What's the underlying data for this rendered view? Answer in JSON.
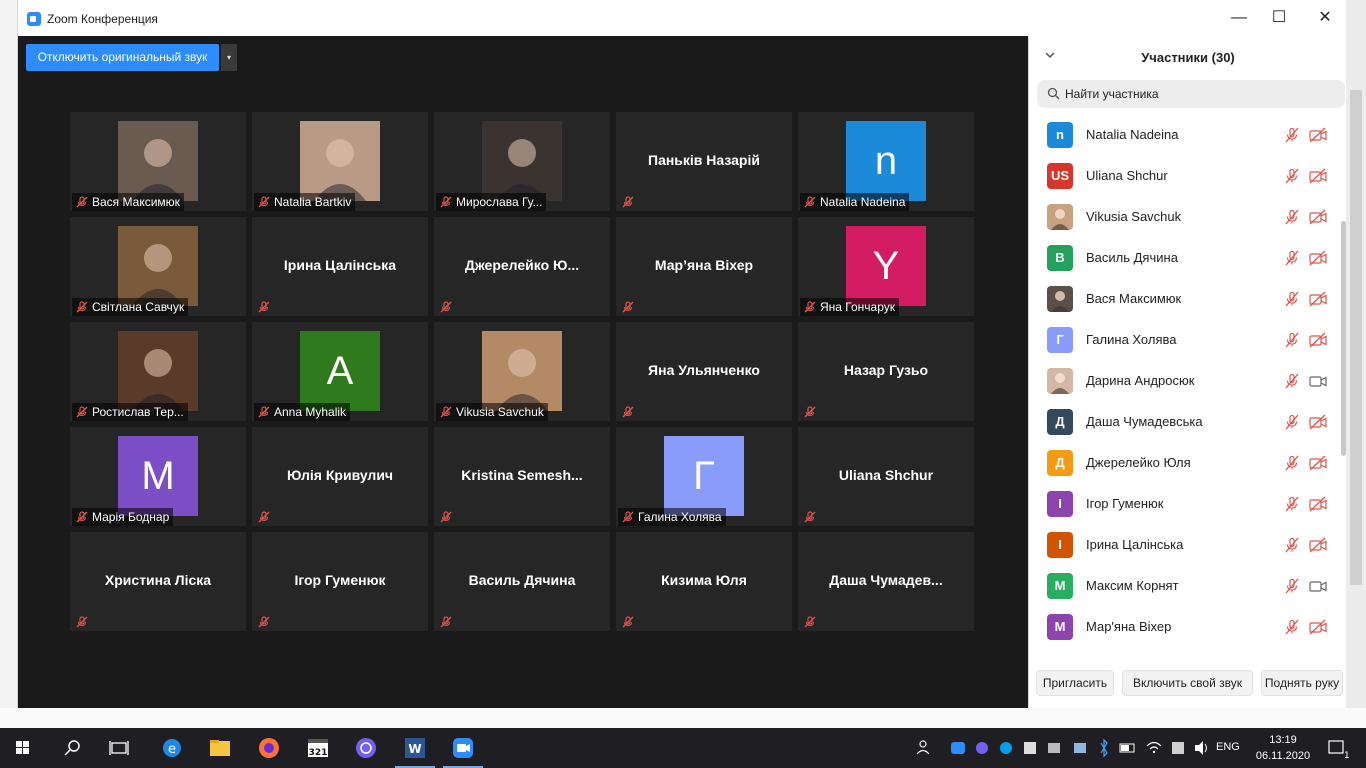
{
  "window": {
    "title": "Zoom Конференция",
    "minimize": "—",
    "maximize": "☐",
    "close": "✕"
  },
  "toolbar": {
    "audio_button": "Отключить оригинальный звук",
    "audio_dropdown": "▾"
  },
  "tiles": [
    {
      "type": "photo",
      "name": "Вася Максимюк",
      "photo_bg": "#6a5b50"
    },
    {
      "type": "photo",
      "name": "Natalia Bartkiv",
      "photo_bg": "#b89a86"
    },
    {
      "type": "photo",
      "name": "Мирослава Гу...",
      "photo_bg": "#3b3330"
    },
    {
      "type": "text",
      "name": "Паньків Назарій"
    },
    {
      "type": "avatar",
      "name": "Natalia Nadeina",
      "letter": "n",
      "color": "#1a8ad9"
    },
    {
      "type": "photo",
      "name": "Світлана Савчук",
      "photo_bg": "#7a5a3a"
    },
    {
      "type": "text",
      "name": "Ірина Цалінська"
    },
    {
      "type": "text",
      "name": "Джерелейко  Ю..."
    },
    {
      "type": "text",
      "name": "Мар’яна Віхер"
    },
    {
      "type": "avatar",
      "name": "Яна Гончарук",
      "letter": "Y",
      "color": "#d31c62"
    },
    {
      "type": "photo",
      "name": "Ростислав Тер...",
      "photo_bg": "#5a3a28"
    },
    {
      "type": "avatar",
      "name": "Anna Myhalik",
      "letter": "A",
      "color": "#2f7a1c"
    },
    {
      "type": "photo",
      "name": "Vikusia Savchuk",
      "photo_bg": "#b48a66"
    },
    {
      "type": "text",
      "name": "Яна Ульянченко"
    },
    {
      "type": "text",
      "name": "Назар Гузьо"
    },
    {
      "type": "avatar",
      "name": "Марія Боднар",
      "letter": "M",
      "color": "#7c4ec6"
    },
    {
      "type": "text",
      "name": "Юлія Кривулич"
    },
    {
      "type": "text",
      "name": "Kristina  Semesh..."
    },
    {
      "type": "avatar",
      "name": "Галина Холява",
      "letter": "Г",
      "color": "#8a9cfa"
    },
    {
      "type": "text",
      "name": "Uliana Shchur"
    },
    {
      "type": "text",
      "name": "Христина Ліска"
    },
    {
      "type": "text",
      "name": "Ігор Гуменюк"
    },
    {
      "type": "text",
      "name": "Василь Дячина"
    },
    {
      "type": "text",
      "name": "Кизима Юля"
    },
    {
      "type": "text",
      "name": "Даша  Чумадев..."
    }
  ],
  "panel": {
    "title": "Участники (30)",
    "search_placeholder": "Найти участника",
    "participants": [
      {
        "name": "Natalia Nadeina",
        "initials": "n",
        "color": "#1a8ad9",
        "cam_off": true
      },
      {
        "name": "Uliana Shchur",
        "initials": "US",
        "color": "#d7362b",
        "cam_off": true
      },
      {
        "name": "Vikusia Savchuk",
        "initials": "",
        "color": "#c9a283",
        "cam_off": true
      },
      {
        "name": "Василь Дячина",
        "initials": "В",
        "color": "#23a15d",
        "cam_off": true
      },
      {
        "name": "Вася Максимюк",
        "initials": "",
        "color": "#5b4f47",
        "cam_off": true
      },
      {
        "name": "Галина Холява",
        "initials": "Г",
        "color": "#8a9cfa",
        "cam_off": true
      },
      {
        "name": "Дарина Андросюк",
        "initials": "",
        "color": "#d4b8a6",
        "cam_off": false
      },
      {
        "name": "Даша Чумадевська",
        "initials": "Д",
        "color": "#34485e",
        "cam_off": true
      },
      {
        "name": "Джерелейко Юля",
        "initials": "Д",
        "color": "#f39c12",
        "cam_off": true
      },
      {
        "name": "Ігор Гуменюк",
        "initials": "І",
        "color": "#8e44ad",
        "cam_off": true
      },
      {
        "name": "Ірина Цалінська",
        "initials": "І",
        "color": "#d35400",
        "cam_off": true
      },
      {
        "name": "Максим Корнят",
        "initials": "М",
        "color": "#27ae60",
        "cam_off": false
      },
      {
        "name": "Мар'яна Віхер",
        "initials": "М",
        "color": "#8e44ad",
        "cam_off": true
      }
    ],
    "invite": "Пригласить",
    "unmute": "Включить свой звук",
    "raise_hand": "Поднять руку"
  },
  "taskbar": {
    "lang": "ENG",
    "time": "13:19",
    "date": "06.11.2020",
    "notifications": "1"
  }
}
